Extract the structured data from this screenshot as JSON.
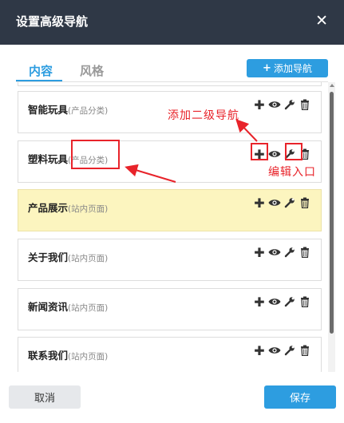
{
  "dialog": {
    "title": "设置高级导航",
    "close_symbol": "✕"
  },
  "tabs": [
    {
      "label": "内容",
      "active": true
    },
    {
      "label": "风格",
      "active": false
    }
  ],
  "add_nav_button": {
    "icon": "plus-icon",
    "label": "添加导航"
  },
  "nav_items": [
    {
      "name": "智能玩具",
      "type": "(产品分类)"
    },
    {
      "name": "塑料玩具",
      "type": "(产品分类)"
    },
    {
      "name": "产品展示",
      "type": "(站内页面)",
      "highlighted": true
    },
    {
      "name": "关于我们",
      "type": "(站内页面)"
    },
    {
      "name": "新闻资讯",
      "type": "(站内页面)"
    },
    {
      "name": "联系我们",
      "type": "(站内页面)"
    }
  ],
  "item_actions": [
    "plus-icon",
    "eye-icon",
    "wrench-icon",
    "trash-icon"
  ],
  "annotations": {
    "add_sub_nav": "添加二级导航",
    "edit_entry": "编辑入口",
    "color": "#e8232a"
  },
  "footer": {
    "cancel_label": "取消",
    "save_label": "保存"
  },
  "colors": {
    "titlebar": "#2f3846",
    "accent": "#2d9de0",
    "highlight_row": "#fcf5bf"
  }
}
